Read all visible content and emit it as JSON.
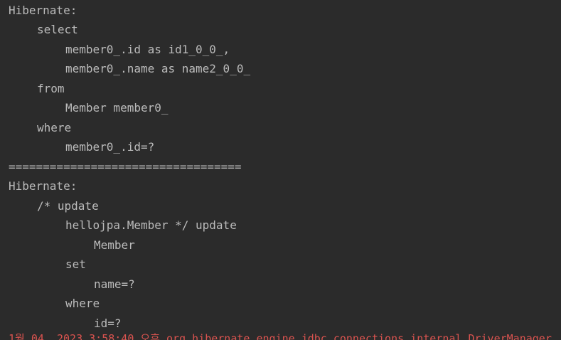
{
  "console": {
    "lines": [
      "Hibernate:",
      "select",
      "member0_.id as id1_0_0_,",
      "member0_.name as name2_0_0_",
      "from",
      "Member member0_",
      "where",
      "member0_.id=?",
      "==================================",
      "Hibernate:",
      "/* update",
      "hellojpa.Member */ update",
      "Member",
      "set",
      "name=?",
      "where",
      "id=?"
    ],
    "partial_error_line": "1월 04, 2023 3:58:40 오후 org.hibernate.engine.jdbc.connections.internal.DriverManager...",
    "colors": {
      "background": "#2b2b2b",
      "text": "#bbbbbb",
      "error": "#d9534f"
    }
  }
}
